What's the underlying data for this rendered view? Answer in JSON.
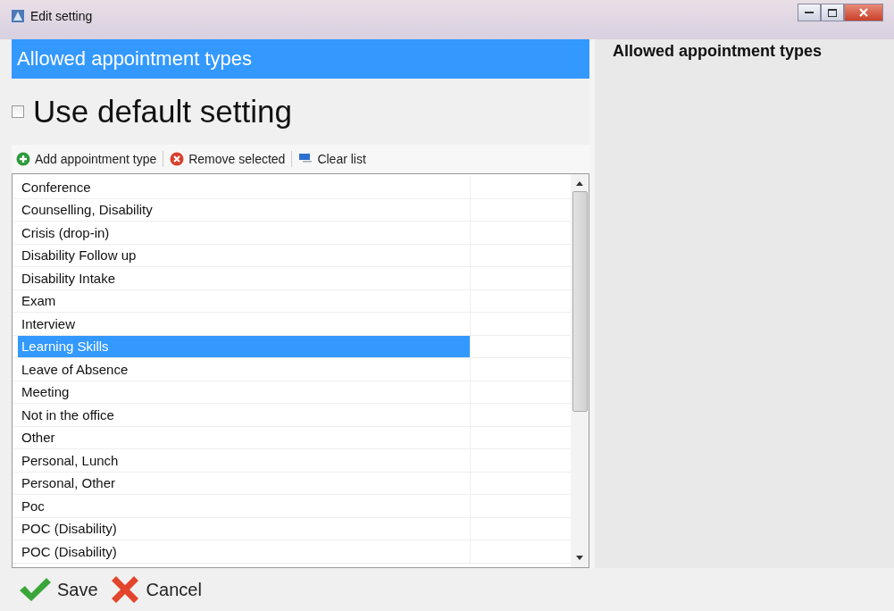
{
  "window": {
    "title": "Edit setting"
  },
  "header": {
    "title": "Allowed appointment types"
  },
  "use_default": {
    "label": "Use default setting",
    "checked": false
  },
  "toolbar": [
    {
      "kind": "add",
      "label": "Add appointment type"
    },
    {
      "kind": "remove",
      "label": "Remove selected"
    },
    {
      "kind": "clear",
      "label": "Clear list"
    }
  ],
  "list": {
    "rows": [
      {
        "label": "Conference",
        "selected": false
      },
      {
        "label": "Counselling, Disability",
        "selected": false
      },
      {
        "label": "Crisis (drop-in)",
        "selected": false
      },
      {
        "label": "Disability Follow up",
        "selected": false
      },
      {
        "label": "Disability Intake",
        "selected": false
      },
      {
        "label": "Exam",
        "selected": false
      },
      {
        "label": "Interview",
        "selected": false
      },
      {
        "label": "Learning Skills",
        "selected": true
      },
      {
        "label": "Leave of Absence",
        "selected": false
      },
      {
        "label": "Meeting",
        "selected": false
      },
      {
        "label": "Not in the office",
        "selected": false
      },
      {
        "label": "Other",
        "selected": false
      },
      {
        "label": "Personal, Lunch",
        "selected": false
      },
      {
        "label": "Personal, Other",
        "selected": false
      },
      {
        "label": "Poc",
        "selected": false
      },
      {
        "label": "POC (Disability)",
        "selected": false
      },
      {
        "label": "POC (Disability)",
        "selected": false
      }
    ]
  },
  "side_panel": {
    "title": "Allowed appointment types"
  },
  "buttons": [
    {
      "kind": "save",
      "label": "Save"
    },
    {
      "kind": "cancel",
      "label": "Cancel"
    }
  ]
}
